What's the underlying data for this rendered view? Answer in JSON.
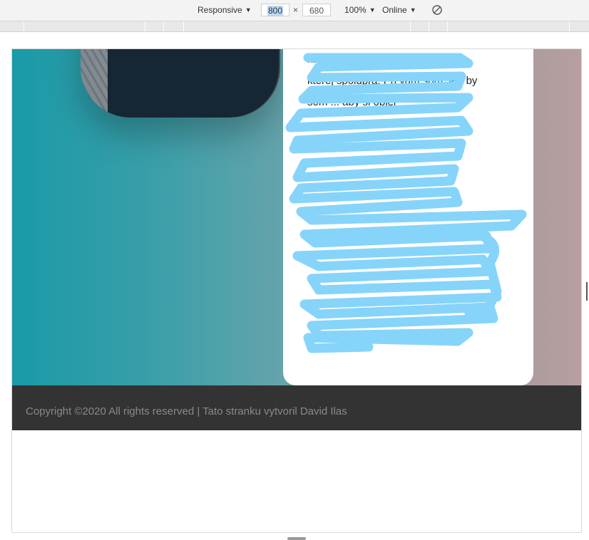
{
  "devtools": {
    "device_label": "Responsive",
    "width_value": "800",
    "height_value": "680",
    "dimension_separator": "×",
    "zoom_label": "100%",
    "throttle_label": "Online",
    "rotate_icon": "rotate-icon",
    "dropdown_icon": "chevron-down-icon"
  },
  "page": {
    "card_text_visible": "ktomu. Kedy a kde ste a dál ja na kterej spolupra. Pri vám som, jed by som ... aby si objel",
    "footer_text": "Copyright ©2020 All rights reserved | Tato stranku vytvoril David Ilas"
  },
  "colors": {
    "hero_left": "#1a9aa8",
    "hero_right": "#b99ea0",
    "footer_bg": "#333333",
    "scribble": "#86d4fa"
  }
}
